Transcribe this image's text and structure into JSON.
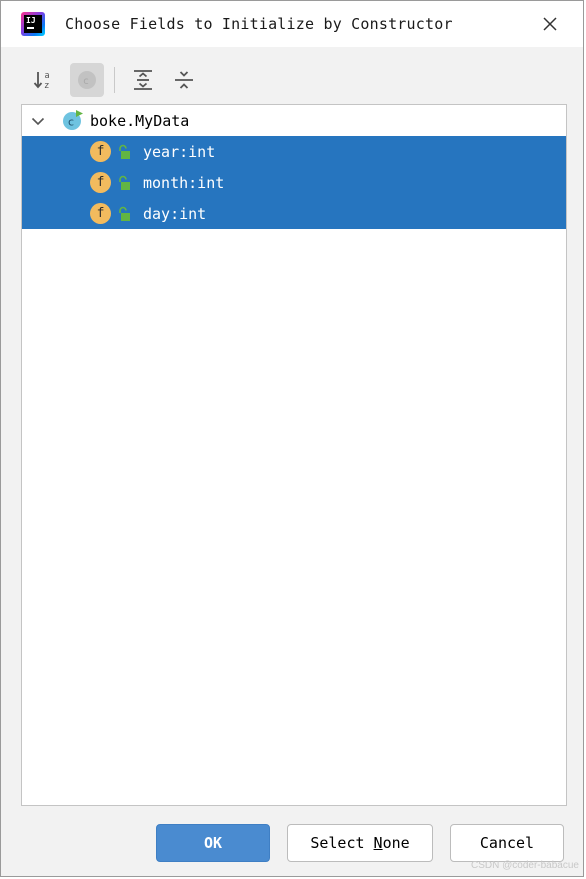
{
  "dialog": {
    "title": "Choose Fields to Initialize by Constructor"
  },
  "toolbar": {
    "icons": [
      "sort-alphabetically-icon",
      "show-classes-icon",
      "expand-all-icon",
      "collapse-all-icon"
    ]
  },
  "tree": {
    "root": {
      "label": "boke.MyData",
      "icon": "class-icon",
      "expanded": true
    },
    "fields": [
      {
        "label": "year:int",
        "icon_letter": "f",
        "selected": true
      },
      {
        "label": "month:int",
        "icon_letter": "f",
        "selected": true
      },
      {
        "label": "day:int",
        "icon_letter": "f",
        "selected": true
      }
    ]
  },
  "buttons": {
    "ok": "OK",
    "select_none_prefix": "Select ",
    "select_none_mnemonic": "N",
    "select_none_suffix": "one",
    "cancel": "Cancel"
  },
  "watermark": "CSDN @coder-babacue",
  "colors": {
    "selection": "#2675bf",
    "ok_button": "#4a8bd0",
    "field_icon": "#f2bb5e",
    "class_icon": "#6ec3e0",
    "lock": "#62b543"
  }
}
